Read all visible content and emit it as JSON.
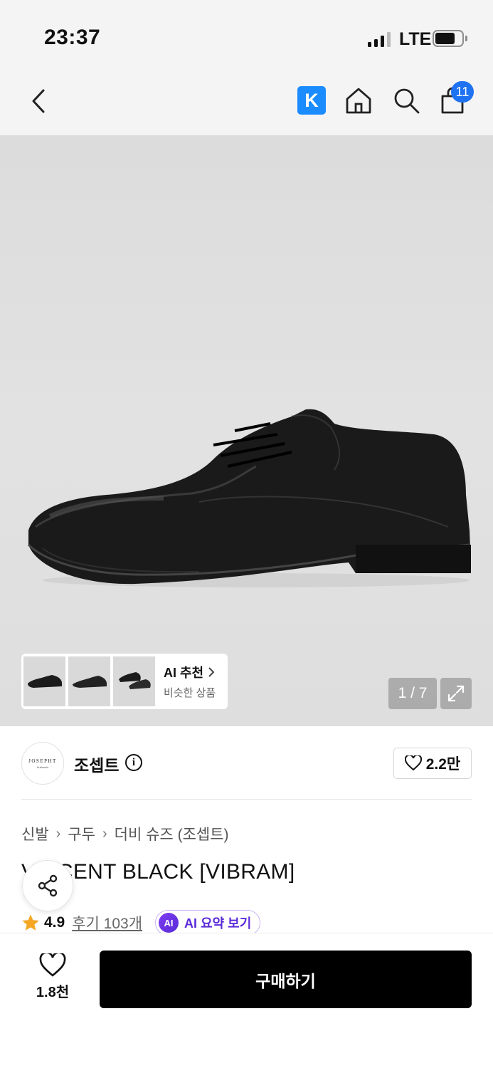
{
  "status_bar": {
    "time": "23:37",
    "network": "LTE"
  },
  "header": {
    "back_icon": "chevron-left-icon",
    "k_logo": "K",
    "home_icon": "home-icon",
    "search_icon": "search-icon",
    "cart_icon": "shopping-bag-icon",
    "cart_badge": "11",
    "accent_color": "#1a8cff",
    "badge_color": "#1f73f2"
  },
  "gallery": {
    "ai_rec_title": "AI 추천",
    "ai_rec_subtitle": "비슷한 상품",
    "page_counter": "1 / 7",
    "expand_icon": "expand-icon"
  },
  "brand": {
    "logo_text": "JOSEPHT",
    "logo_sub": "Authentic",
    "name": "조셉트",
    "info_icon": "info-icon",
    "likes": "2.2만"
  },
  "breadcrumb": [
    "신발",
    "구두",
    "더비 슈즈 (조셉트)"
  ],
  "product": {
    "title": "VINCENT BLACK [VIBRAM]",
    "rating": "4.9",
    "reviews": "후기 103개",
    "ai_chip": "AI",
    "ai_summary": "AI 요약 보기",
    "ai_color": "#5a2bd9"
  },
  "bottom_bar": {
    "wish_count": "1.8천",
    "buy_label": "구매하기"
  }
}
